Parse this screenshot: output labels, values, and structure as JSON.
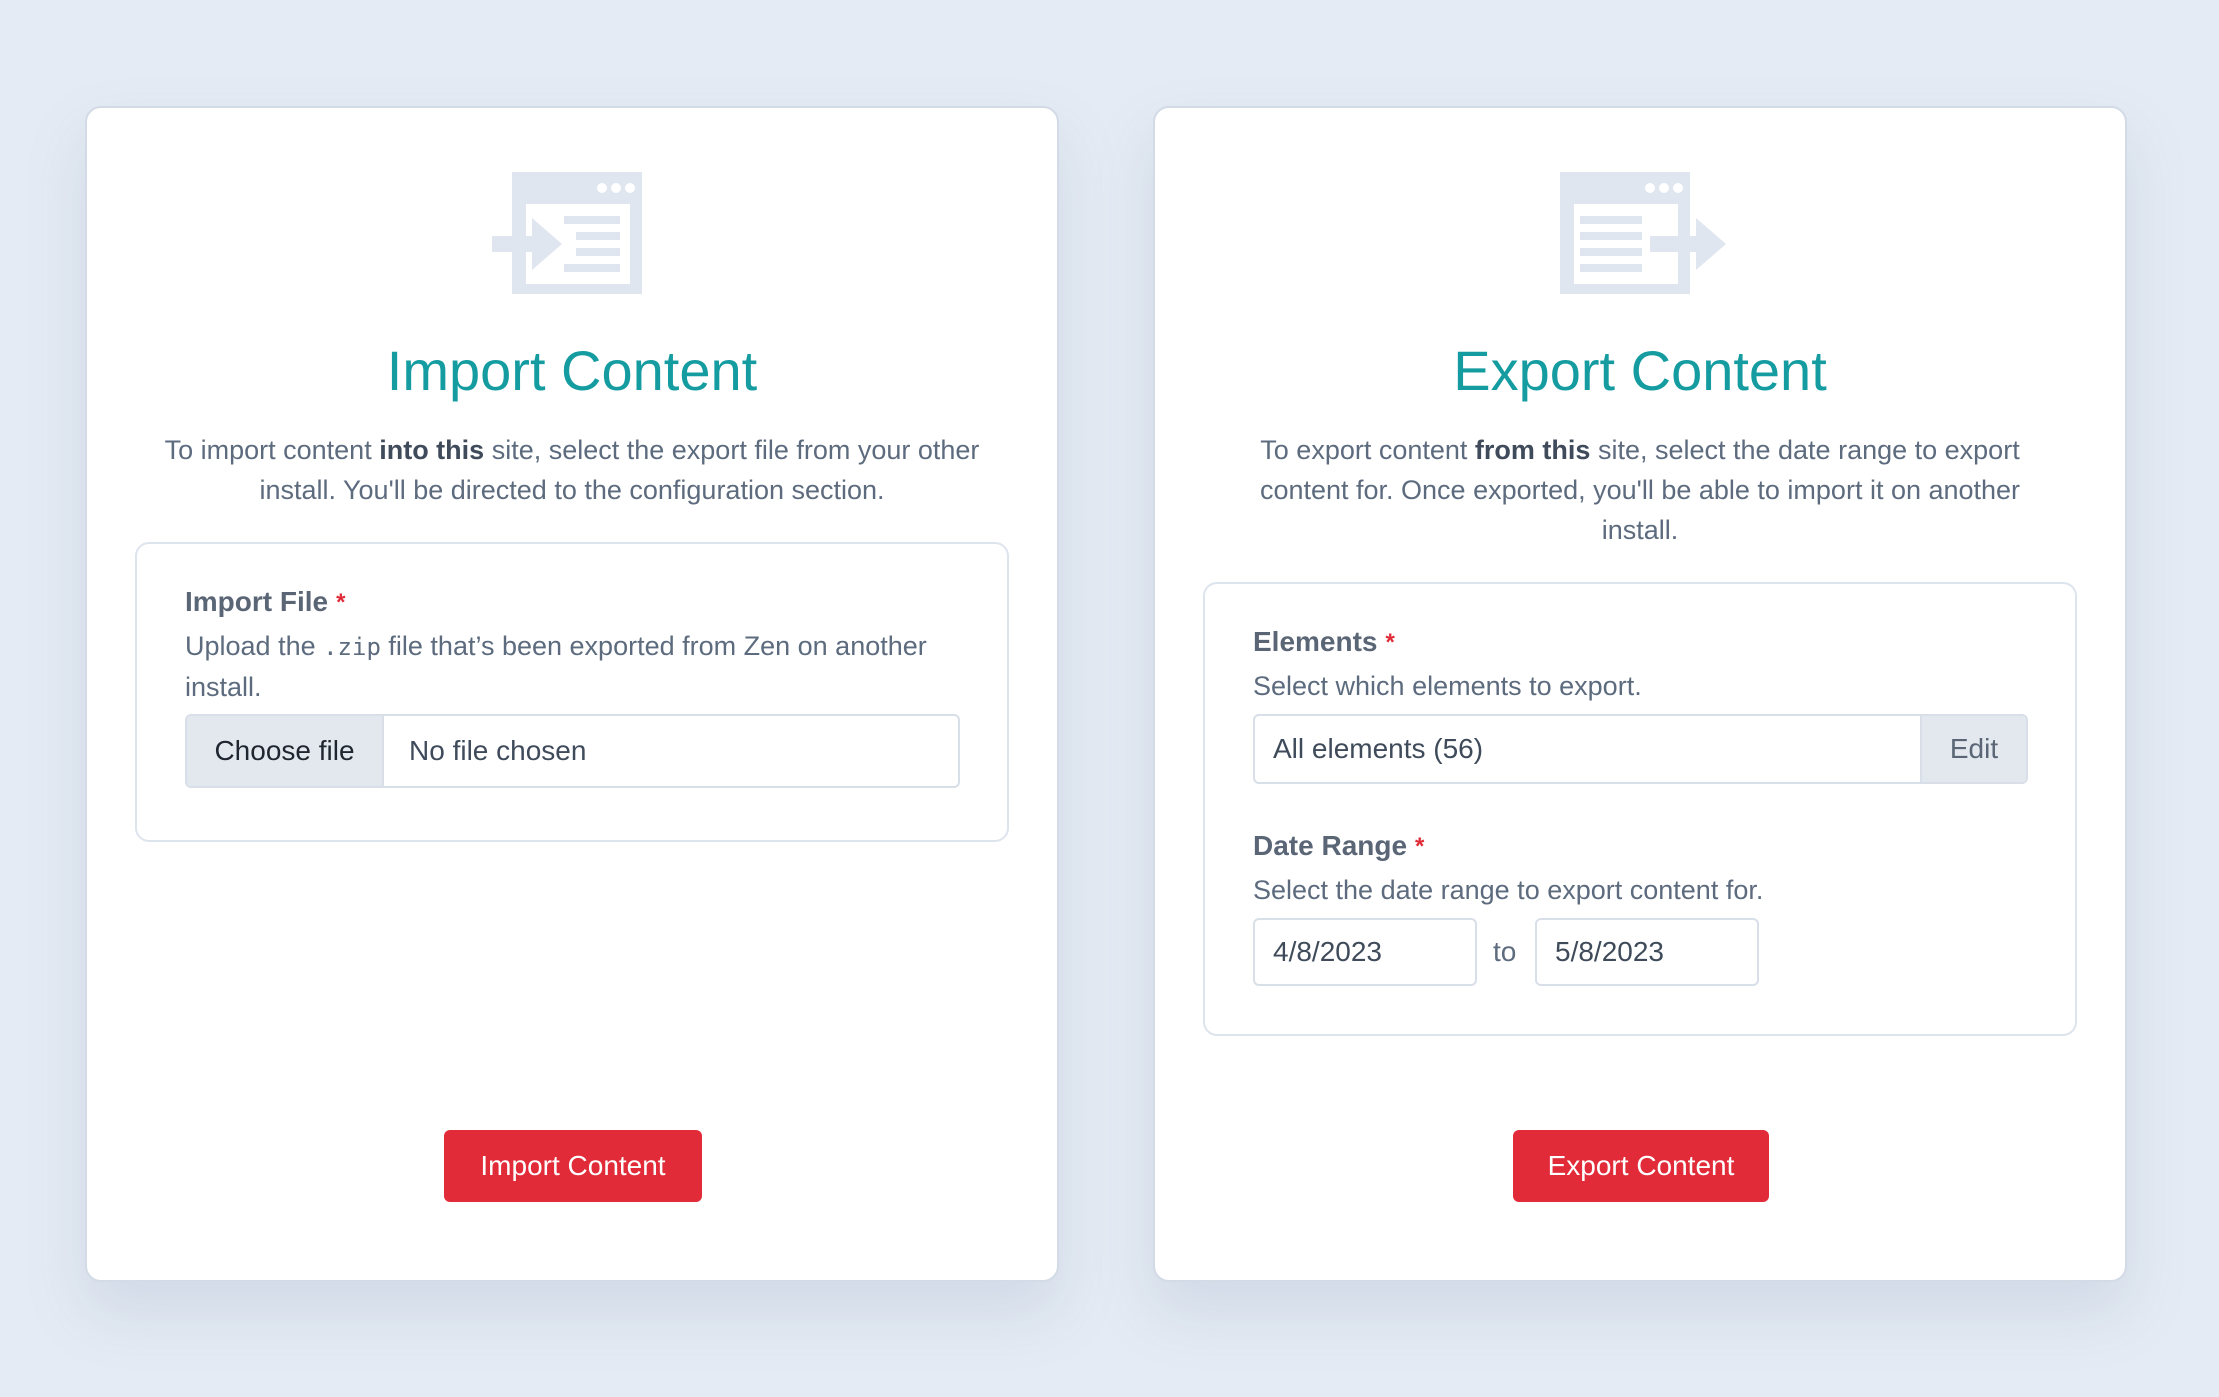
{
  "import": {
    "title": "Import Content",
    "desc_prefix": "To import content ",
    "desc_bold": "into this",
    "desc_suffix": " site, select the export file from your other install. You'll be directed to the configuration section.",
    "field_label": "Import File",
    "required_mark": "*",
    "help_prefix": "Upload the ",
    "help_code": ".zip",
    "help_suffix": " file that’s been exported from Zen on another install.",
    "choose_file_label": "Choose file",
    "file_status": "No file chosen",
    "button_label": "Import Content"
  },
  "export": {
    "title": "Export Content",
    "desc_prefix": "To export content ",
    "desc_bold": "from this",
    "desc_suffix": " site, select the date range to export content for. Once exported, you'll be able to import it on another install.",
    "elements_label": "Elements",
    "elements_help": "Select which elements to export.",
    "elements_value": "All elements (56)",
    "edit_label": "Edit",
    "date_label": "Date Range",
    "date_help": "Select the date range to export content for.",
    "date_from": "4/8/2023",
    "date_separator": "to",
    "date_to": "5/8/2023",
    "required_mark": "*",
    "button_label": "Export Content"
  },
  "colors": {
    "accent_title": "#149ca0",
    "primary_button": "#e22b39",
    "background": "#e4ebf4",
    "icon": "#dfe6ef"
  },
  "icons": [
    "import-document-icon",
    "export-document-icon"
  ]
}
